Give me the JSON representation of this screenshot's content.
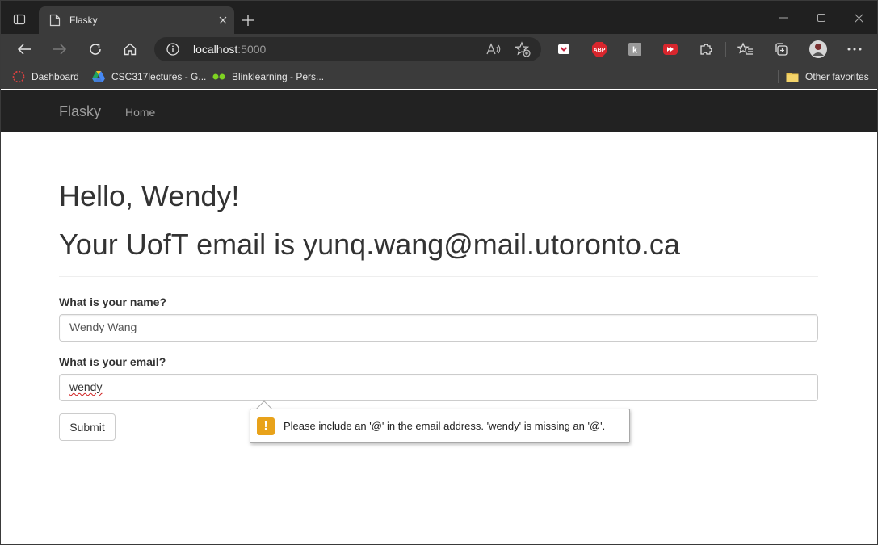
{
  "browser": {
    "tab_title": "Flasky",
    "url_host": "localhost",
    "url_port": ":5000",
    "bookmarks": [
      {
        "label": "Dashboard",
        "icon": "dashboard-icon"
      },
      {
        "label": "CSC317lectures - G...",
        "icon": "google-drive-icon"
      },
      {
        "label": "Blinklearning - Pers...",
        "icon": "blinklearning-icon"
      }
    ],
    "other_favorites": "Other favorites",
    "extensions": [
      "pocket-icon",
      "adblock-plus-icon",
      "extension-k-icon",
      "video-speed-icon",
      "puzzle-icon"
    ],
    "extension_labels": {
      "abp": "ABP",
      "k": "k"
    }
  },
  "navbar": {
    "brand": "Flasky",
    "home": "Home"
  },
  "main": {
    "greeting": "Hello, Wendy!",
    "email_line": "Your UofT email is yunq.wang@mail.utoronto.ca"
  },
  "form": {
    "name_label": "What is your name?",
    "name_value": "Wendy Wang",
    "email_label": "What is your email?",
    "email_value": "wendy",
    "submit_label": "Submit"
  },
  "validation": {
    "icon_glyph": "!",
    "message": "Please include an '@' in the email address. 'wendy' is missing an '@'."
  },
  "colors": {
    "navbar_bg": "#222222",
    "navbar_text": "#9d9d9d",
    "warning": "#e8a21a"
  }
}
